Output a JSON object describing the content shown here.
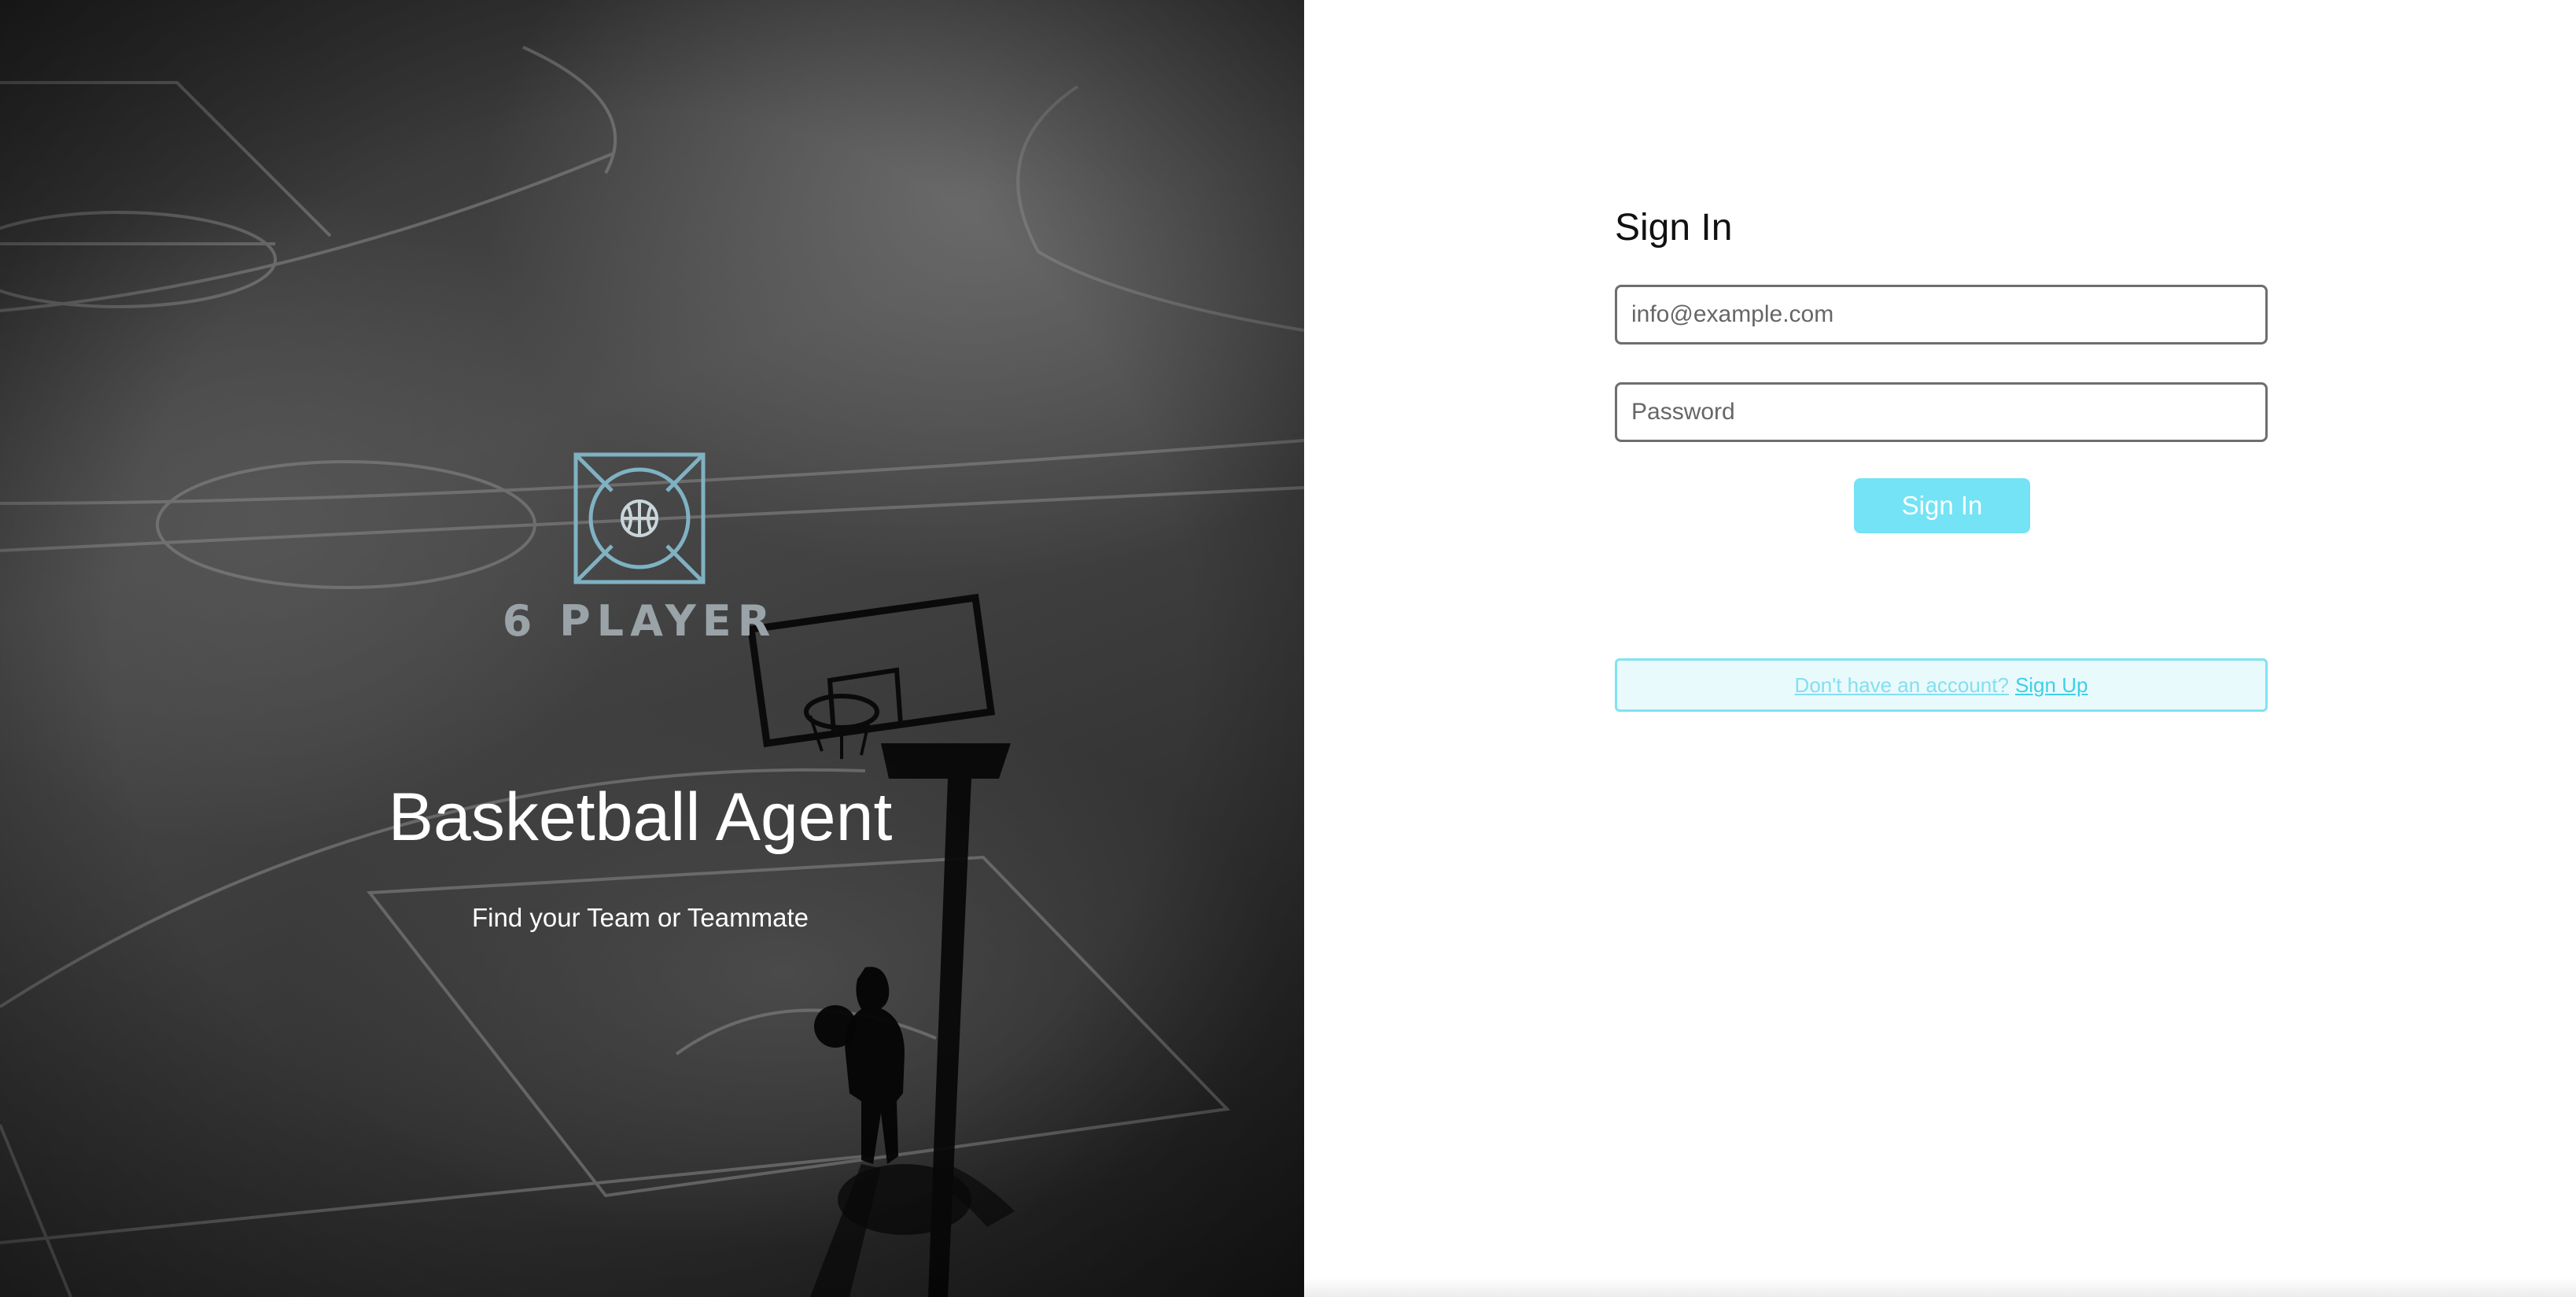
{
  "hero": {
    "brand_name": "6 PLAYER",
    "title": "Basketball Agent",
    "subtitle": "Find your Team or Teammate",
    "logo_icon": "basketball-emblem-icon",
    "background_image": "basketball-court-photo"
  },
  "auth": {
    "title": "Sign In",
    "email_placeholder": "info@example.com",
    "password_placeholder": "Password",
    "submit_label": "Sign In",
    "signup_prompt": "Don't have an account?",
    "signup_link": "Sign Up"
  },
  "colors": {
    "accent": "#74e3f5",
    "signup_border": "#7fe3f2",
    "signup_background": "#e9fafd",
    "logo": "#7fb2c2"
  }
}
